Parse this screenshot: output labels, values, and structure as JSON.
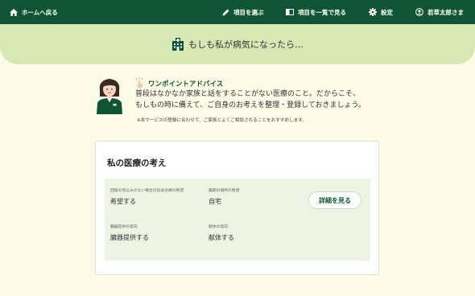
{
  "nav": {
    "home_label": "ホームへ戻る",
    "select_items_label": "項目を選ぶ",
    "view_all_label": "項目を一覧で見る",
    "settings_label": "設定",
    "user_label": "若草太郎さま"
  },
  "hero": {
    "title": "もしも私が病気になったら…",
    "icon": "hospital-icon"
  },
  "advice": {
    "title": "ワンポイントアドバイス",
    "body_line1": "普段はなかなか家族と話をすることがない医療のこと。だからこそ、",
    "body_line2": "もしもの時に備えて、ご自身のお考えを整理・登録しておきましょう。",
    "note": "※本サービスの登録に合わせて、ご家族とよくご相談されることをおすすめします。"
  },
  "card": {
    "title": "私の医療の考え",
    "detail_button": "詳細を見る",
    "fields": [
      {
        "label": "回復の見込みがない場合の延命治療の希望",
        "value": "希望する"
      },
      {
        "label": "最期の場所の希望",
        "value": "自宅"
      },
      {
        "label": "臓器提供の意向",
        "value": "臓器提供する"
      },
      {
        "label": "献体の意向",
        "value": "献体する"
      }
    ]
  },
  "colors": {
    "header_bg": "#0f5535",
    "hero_bg": "#d8e8b4",
    "page_bg": "#fdfbe8",
    "panel_bg": "#eef4e3",
    "accent": "#0f5535",
    "highlight": "#f3a33a"
  }
}
